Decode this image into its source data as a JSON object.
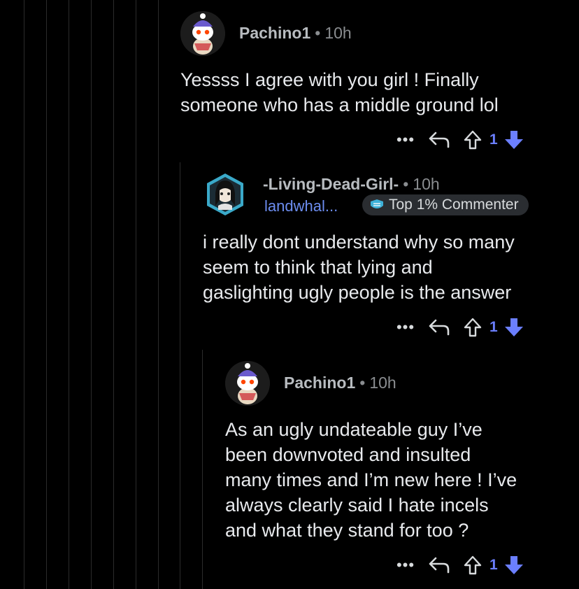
{
  "colors": {
    "background": "#000000",
    "vote_accent": "#6b7fff",
    "downvote_fill": "#6b7fff",
    "flair_link": "#6c8df0"
  },
  "comments": [
    {
      "author": "Pachino1",
      "age": "10h",
      "avatar": "snoo-avatar-winter",
      "body": "Yessss I agree with you girl ! Finally\nsomeone who has a middle ground lol",
      "score": "1"
    },
    {
      "author": "-Living-Dead-Girl-",
      "age": "10h",
      "avatar": "hex-avatar-girl",
      "user_flair": "landwhal...",
      "badge": "Top 1% Commenter",
      "body": "i really dont understand why so many\nseem to think that lying and\ngaslighting ugly people is the answer",
      "score": "1"
    },
    {
      "author": "Pachino1",
      "age": "10h",
      "avatar": "snoo-avatar-winter",
      "body": "As an ugly undateable guy I’ve\nbeen downvoted and insulted\nmany times and I’m new here ! I’ve\nalways clearly said I hate incels\nand what they stand for too ?",
      "score": "1"
    }
  ],
  "separator_dot": "•",
  "more_label": "•••"
}
